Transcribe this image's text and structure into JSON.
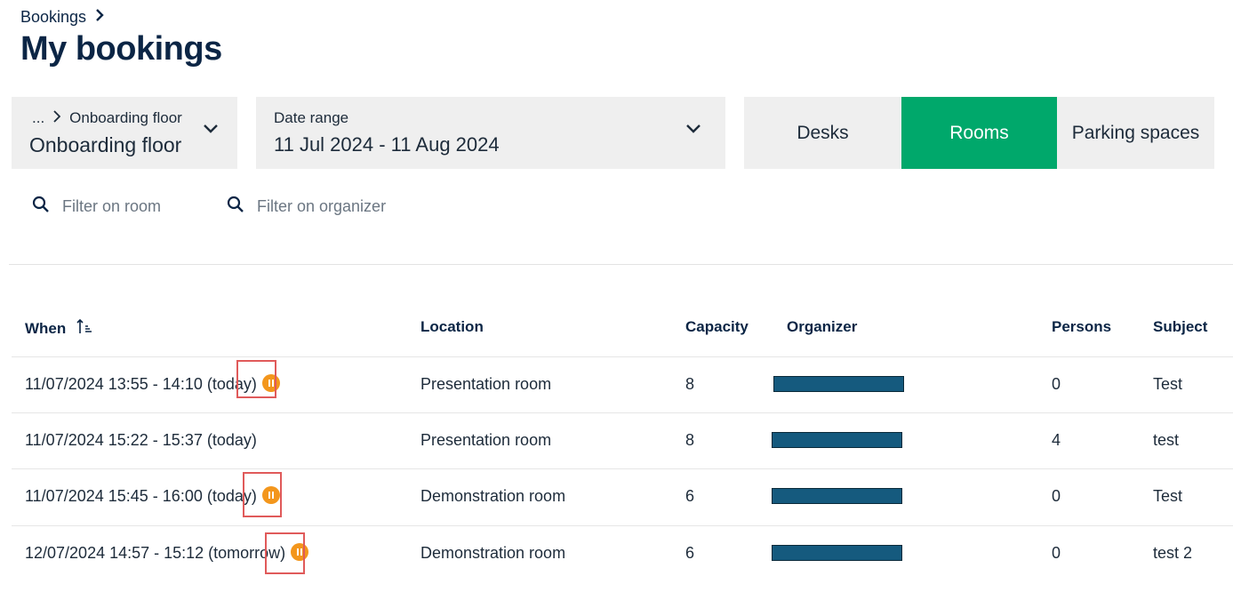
{
  "breadcrumb": {
    "parent": "Bookings"
  },
  "page": {
    "title": "My bookings"
  },
  "floor_selector": {
    "crumb_prefix": "...",
    "crumb_label": "Onboarding floor",
    "value": "Onboarding floor"
  },
  "date_range": {
    "label": "Date range",
    "value": "11 Jul 2024 - 11 Aug 2024"
  },
  "tabs": [
    {
      "label": "Desks",
      "active": false
    },
    {
      "label": "Rooms",
      "active": true
    },
    {
      "label": "Parking spaces",
      "active": false
    }
  ],
  "filters": {
    "room_placeholder": "Filter on room",
    "organizer_placeholder": "Filter on organizer"
  },
  "table": {
    "headers": {
      "when": "When",
      "location": "Location",
      "capacity": "Capacity",
      "organizer": "Organizer",
      "persons": "Persons",
      "subject": "Subject"
    },
    "rows": [
      {
        "when": "11/07/2024 13:55 - 14:10 (today)",
        "pending": true,
        "location": "Presentation room",
        "capacity": "8",
        "persons": "0",
        "subject": "Test"
      },
      {
        "when": "11/07/2024 15:22 - 15:37 (today)",
        "pending": false,
        "location": "Presentation room",
        "capacity": "8",
        "persons": "4",
        "subject": "test"
      },
      {
        "when": "11/07/2024 15:45 - 16:00 (today)",
        "pending": true,
        "location": "Demonstration room",
        "capacity": "6",
        "persons": "0",
        "subject": "Test"
      },
      {
        "when": "12/07/2024 14:57 - 15:12 (tomorrow)",
        "pending": true,
        "location": "Demonstration room",
        "capacity": "6",
        "persons": "0",
        "subject": "test 2"
      }
    ]
  },
  "colors": {
    "accent": "#00a86b",
    "pending_badge": "#f3961c",
    "redacted_bar": "#155a7e",
    "highlight_box": "#e05a5a"
  },
  "icons": [
    "chevron-right-icon",
    "chevron-down-icon",
    "search-icon",
    "sort-ascending-icon",
    "pause-icon"
  ]
}
